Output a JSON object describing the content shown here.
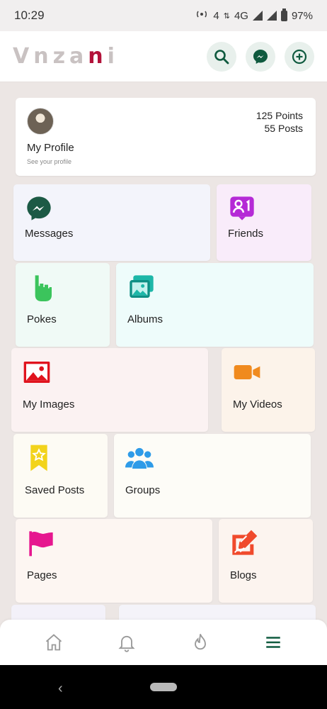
{
  "status_bar": {
    "time": "10:29",
    "network": "4G",
    "battery": "97%",
    "hotspot_count": "4"
  },
  "header": {
    "logo_text_left": "V",
    "logo_text_mid": "nza",
    "logo_text_accent": "n",
    "logo_text_right": "i"
  },
  "profile": {
    "name": "My Profile",
    "subtitle": "See your profile",
    "points": "125 Points",
    "posts": "55 Posts"
  },
  "tiles": [
    {
      "label": "Messages",
      "icon": "messenger-icon",
      "color": "#1c5a45"
    },
    {
      "label": "Friends",
      "icon": "friends-icon",
      "color": "#b52ad6"
    },
    {
      "label": "Pokes",
      "icon": "poke-hand-icon",
      "color": "#3bc45c"
    },
    {
      "label": "Albums",
      "icon": "albums-icon",
      "color": "#1db7a8"
    },
    {
      "label": "My Images",
      "icon": "image-icon",
      "color": "#e0141e"
    },
    {
      "label": "My Videos",
      "icon": "video-camera-icon",
      "color": "#f08a1e"
    },
    {
      "label": "Saved Posts",
      "icon": "bookmark-star-icon",
      "color": "#f2d31c"
    },
    {
      "label": "Groups",
      "icon": "groups-icon",
      "color": "#2e9be8"
    },
    {
      "label": "Pages",
      "icon": "flag-icon",
      "color": "#e6178f"
    },
    {
      "label": "Blogs",
      "icon": "blog-edit-icon",
      "color": "#f04a2c"
    }
  ],
  "bottom_nav": [
    "home-icon",
    "bell-icon",
    "trending-fire-icon",
    "menu-icon"
  ]
}
